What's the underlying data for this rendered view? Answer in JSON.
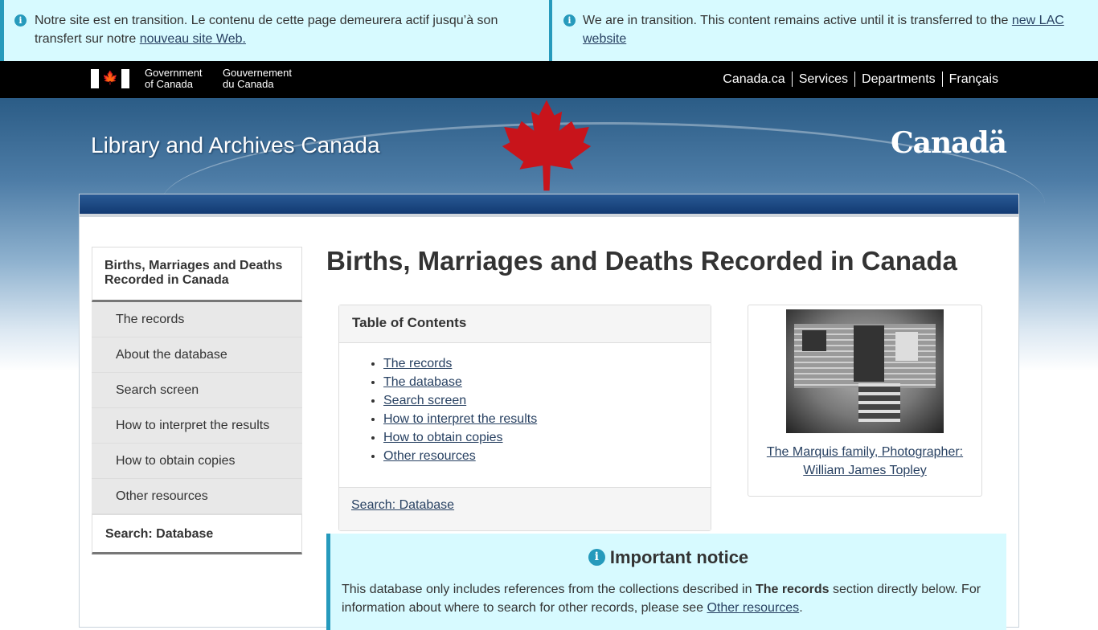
{
  "banners": {
    "fr": {
      "text": "Notre site est en transition. Le contenu de cette page demeurera actif jusqu’à son transfert sur notre ",
      "link": "nouveau site Web."
    },
    "en": {
      "text": "We are in transition. This content remains active until it is transferred to the ",
      "link": "new LAC website"
    }
  },
  "gov_bar": {
    "signature_en": [
      "Government",
      "of Canada"
    ],
    "signature_fr": [
      "Gouvernement",
      "du Canada"
    ],
    "nav": [
      "Canada.ca",
      "Services",
      "Departments",
      "Français"
    ]
  },
  "site": {
    "title": "Library and Archives Canada",
    "wordmark": "Canadä"
  },
  "sidenav": {
    "heading": "Births, Marriages and Deaths Recorded in Canada",
    "items": [
      "The records",
      "About the database",
      "Search screen",
      "How to interpret the results",
      "How to obtain copies",
      "Other resources"
    ],
    "footer": "Search: Database"
  },
  "main": {
    "title": "Births, Marriages and Deaths Recorded in Canada",
    "toc": {
      "heading": "Table of Contents",
      "links": [
        "The records",
        "The database",
        "Search screen",
        "How to interpret the results",
        "How to obtain copies",
        "Other resources"
      ],
      "footer_link": "Search: Database"
    },
    "figure": {
      "caption": "The Marquis family, Photographer: William James Topley"
    },
    "notice": {
      "heading": "Important notice",
      "text_before": "This database only includes references from the collections described in ",
      "bold": "The records",
      "text_middle": " section directly below. For information about where to search for other records, please see ",
      "link": "Other resources",
      "text_after": "."
    }
  },
  "colors": {
    "banner_bg": "#d7faff",
    "info_accent": "#269abc",
    "link": "#284162",
    "gov_bar": "#000000"
  }
}
